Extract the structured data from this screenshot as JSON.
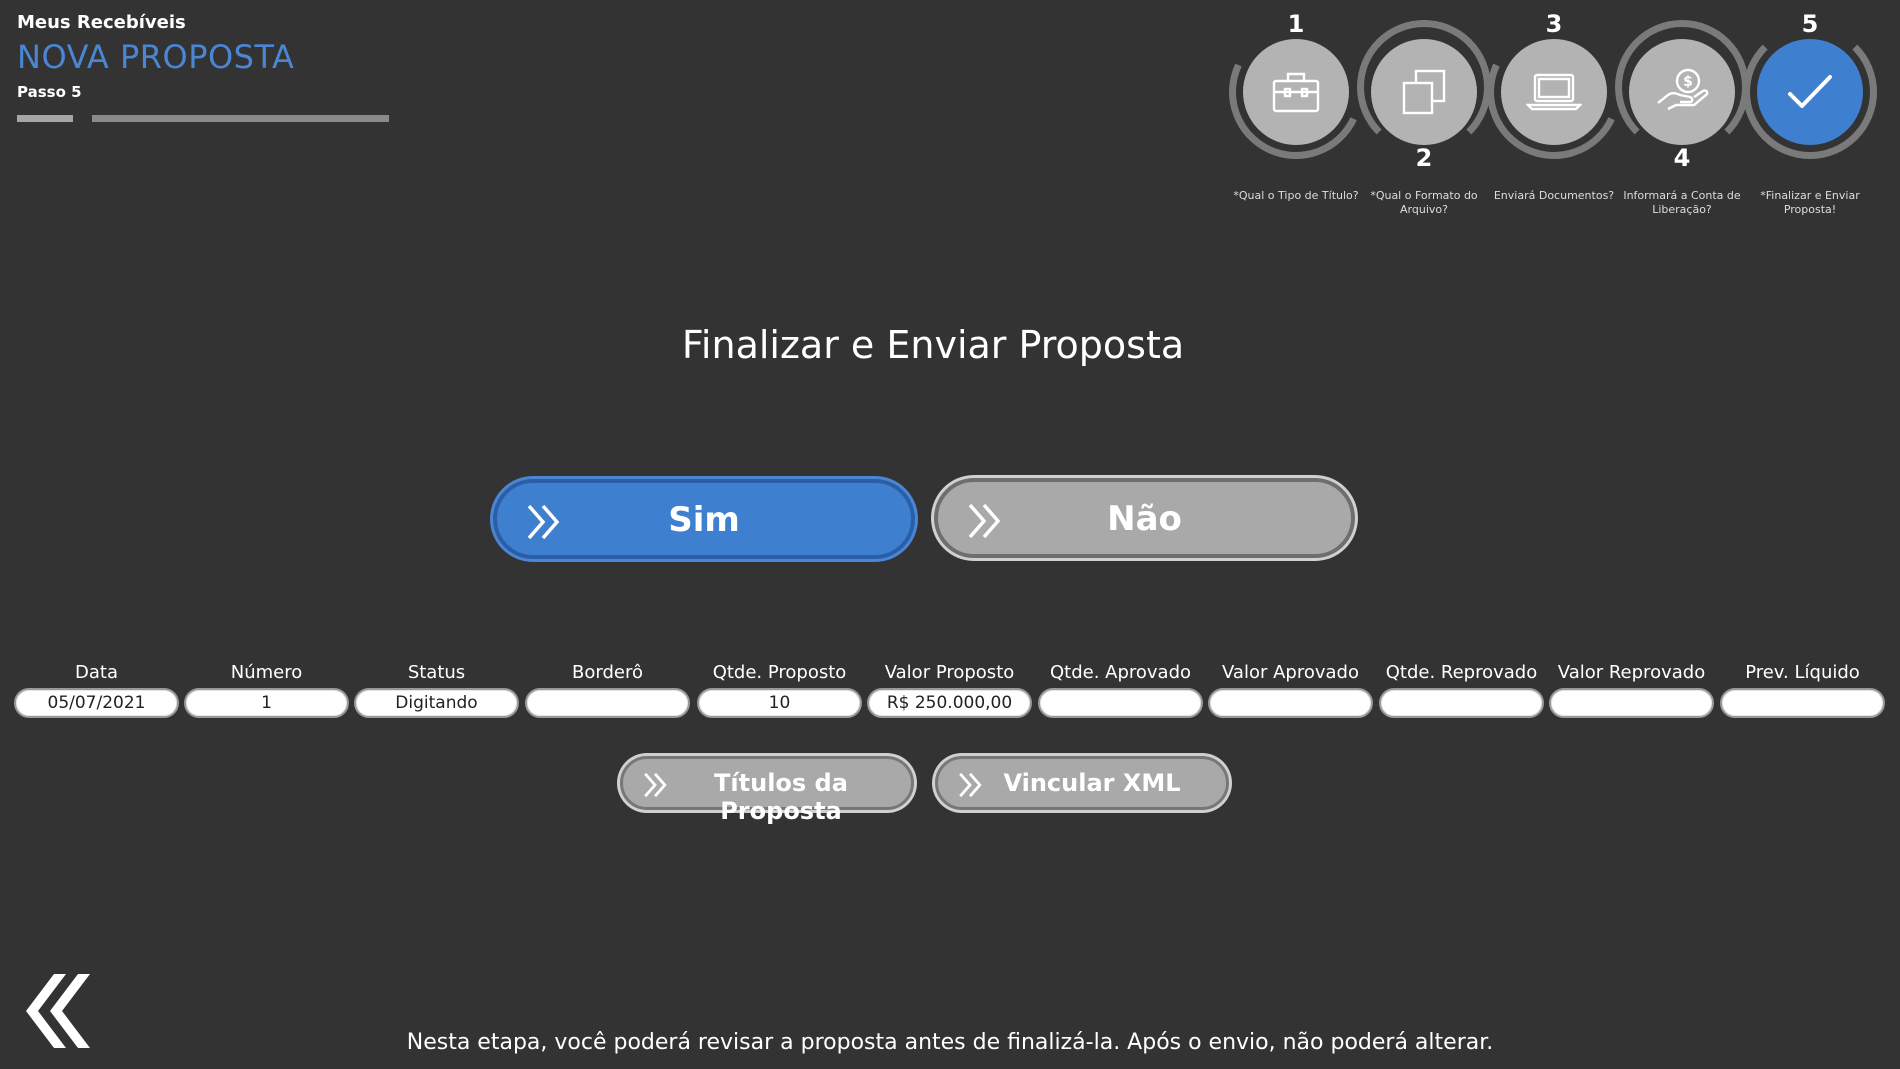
{
  "header": {
    "app_name": "Meus Recebíveis",
    "title": "NOVA PROPOSTA",
    "step": "Passo 5",
    "progress_fraction": 0.2
  },
  "stepper": [
    {
      "number": "1",
      "icon": "briefcase-icon",
      "label": "*Qual o Tipo de Título?",
      "active": false
    },
    {
      "number": "2",
      "icon": "copy-icon",
      "label": "*Qual o Formato do Arquivo?",
      "active": false
    },
    {
      "number": "3",
      "icon": "laptop-icon",
      "label": "Enviará Documentos?",
      "active": false
    },
    {
      "number": "4",
      "icon": "hand-money-icon",
      "label": "Informará a Conta de Liberação?",
      "active": false
    },
    {
      "number": "5",
      "icon": "check-icon",
      "label": "*Finalizar e Enviar Proposta!",
      "active": true
    }
  ],
  "main": {
    "title": "Finalizar e Enviar Proposta",
    "yes_label": "Sim",
    "no_label": "Não"
  },
  "fields": [
    {
      "label": "Data",
      "value": "05/07/2021"
    },
    {
      "label": "Número",
      "value": "1"
    },
    {
      "label": "Status",
      "value": "Digitando"
    },
    {
      "label": "Borderô",
      "value": ""
    },
    {
      "label": "Qtde. Proposto",
      "value": "10"
    },
    {
      "label": "Valor Proposto",
      "value": "R$ 250.000,00"
    },
    {
      "label": "Qtde. Aprovado",
      "value": ""
    },
    {
      "label": "Valor Aprovado",
      "value": ""
    },
    {
      "label": "Qtde. Reprovado",
      "value": ""
    },
    {
      "label": "Valor Reprovado",
      "value": ""
    },
    {
      "label": "Prev. Líquido",
      "value": ""
    }
  ],
  "actions": {
    "titles_label": "Títulos da Proposta",
    "xml_label": "Vincular XML"
  },
  "footer": {
    "text": "Nesta etapa, você poderá revisar a proposta antes de finalizá-la. Após o envio, não poderá alterar."
  },
  "colors": {
    "background": "#333333",
    "accent": "#3f7fd0",
    "title": "#4a86d4",
    "inactive": "#b3b3b3"
  }
}
